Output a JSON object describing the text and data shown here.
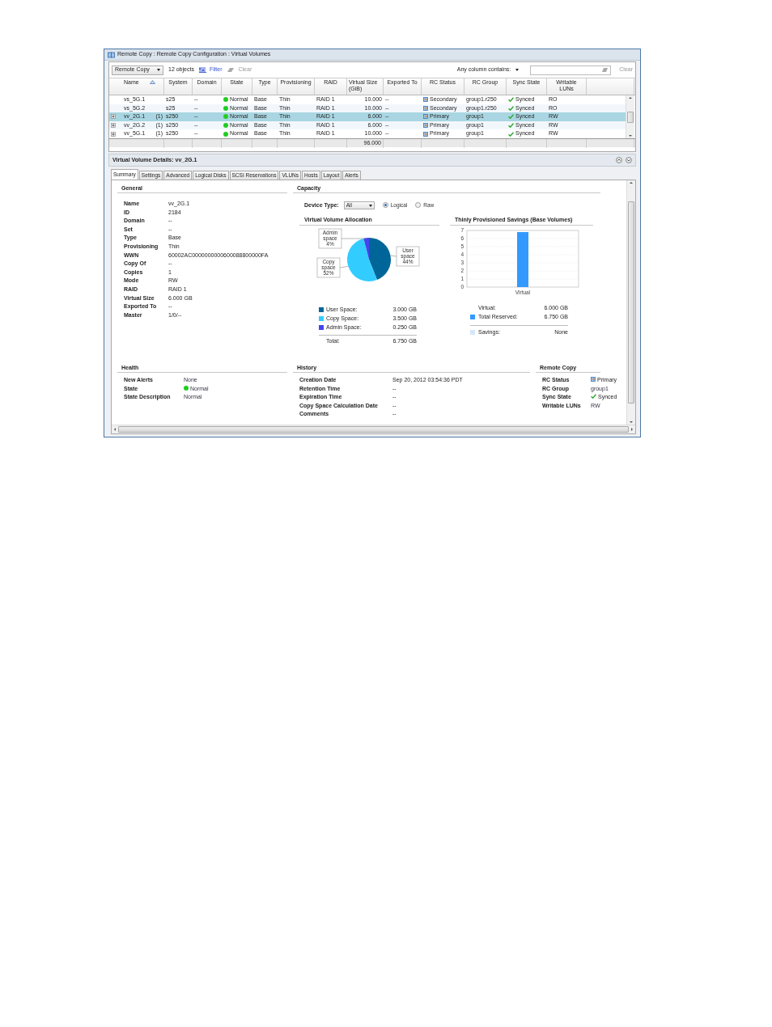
{
  "window": {
    "title": "Remote Copy : Remote Copy Configuration : Virtual Volumes"
  },
  "toolbar": {
    "view_select": "Remote Copy",
    "object_count": "12 objects",
    "filter": "Filter",
    "clear": {
      "label": "Clear",
      "disabled": true
    },
    "search_label": "Any column contains:",
    "search_clear": "Clear"
  },
  "table": {
    "columns": [
      "Name",
      "System",
      "Domain",
      "State",
      "Type",
      "Provisioning",
      "RAID",
      "Virtual Size (GiB)",
      "Exported To",
      "RC Status",
      "RC Group",
      "Sync State",
      "Writable LUNs"
    ],
    "rows": [
      {
        "expandable": false,
        "selected": false,
        "name": "vs_5G.1",
        "system": "s25",
        "domain": "--",
        "state": "Normal",
        "type": "Base",
        "provisioning": "Thin",
        "raid": "RAID 1",
        "virtual_size": "10.000",
        "exported_to": "--",
        "rc_status": "Secondary",
        "rc_group": "group1.r250",
        "sync_state": "Synced",
        "writable_luns": "RO"
      },
      {
        "expandable": false,
        "selected": false,
        "name": "vs_5G.2",
        "system": "s25",
        "domain": "--",
        "state": "Normal",
        "type": "Base",
        "provisioning": "Thin",
        "raid": "RAID 1",
        "virtual_size": "10.000",
        "exported_to": "--",
        "rc_status": "Secondary",
        "rc_group": "group1.r250",
        "sync_state": "Synced",
        "writable_luns": "RO"
      },
      {
        "expandable": true,
        "selected": true,
        "name": "vv_2G.1",
        "count": "(1)",
        "system": "s250",
        "domain": "--",
        "state": "Normal",
        "type": "Base",
        "provisioning": "Thin",
        "raid": "RAID 1",
        "virtual_size": "6.000",
        "exported_to": "--",
        "rc_status": "Primary",
        "rc_group": "group1",
        "sync_state": "Synced",
        "writable_luns": "RW"
      },
      {
        "expandable": true,
        "selected": false,
        "name": "vv_2G.2",
        "count": "(1)",
        "system": "s250",
        "domain": "--",
        "state": "Normal",
        "type": "Base",
        "provisioning": "Thin",
        "raid": "RAID 1",
        "virtual_size": "6.000",
        "exported_to": "--",
        "rc_status": "Primary",
        "rc_group": "group1",
        "sync_state": "Synced",
        "writable_luns": "RW"
      },
      {
        "expandable": true,
        "selected": false,
        "name": "vv_5G.1",
        "count": "(1)",
        "system": "s250",
        "domain": "--",
        "state": "Normal",
        "type": "Base",
        "provisioning": "Thin",
        "raid": "RAID 1",
        "virtual_size": "10.000",
        "exported_to": "--",
        "rc_status": "Primary",
        "rc_group": "group1",
        "sync_state": "Synced",
        "writable_luns": "RW"
      }
    ],
    "virtual_size_total": "96.000"
  },
  "details": {
    "title": "Virtual Volume Details: vv_2G.1",
    "tabs": [
      {
        "label": "Summary",
        "selected": true
      },
      {
        "label": "Settings",
        "selected": false
      },
      {
        "label": "Advanced",
        "selected": false
      },
      {
        "label": "Logical Disks",
        "selected": false
      },
      {
        "label": "SCSI Reservations",
        "selected": false
      },
      {
        "label": "VLUNs",
        "selected": false
      },
      {
        "label": "Hosts",
        "selected": false
      },
      {
        "label": "Layout",
        "selected": false
      },
      {
        "label": "Alerts",
        "selected": false
      }
    ],
    "general": {
      "title": "General",
      "fields": [
        {
          "label": "Name",
          "value": "vv_2G.1"
        },
        {
          "label": "ID",
          "value": "2184"
        },
        {
          "label": "Domain",
          "value": "--"
        },
        {
          "label": "Set",
          "value": "--"
        },
        {
          "label": "Type",
          "value": "Base"
        },
        {
          "label": "Provisioning",
          "value": "Thin"
        },
        {
          "label": "WWN",
          "value": "60002AC0000000000600088800000FA"
        },
        {
          "label": "Copy Of",
          "value": "--"
        },
        {
          "label": "Copies",
          "value": "1"
        },
        {
          "label": "Mode",
          "value": "RW"
        },
        {
          "label": "RAID",
          "value": "RAID 1"
        },
        {
          "label": "Virtual Size",
          "value": "6.000 GB"
        },
        {
          "label": "Exported To",
          "value": "--"
        },
        {
          "label": "Master",
          "value": "1/0/--"
        }
      ]
    },
    "capacity": {
      "title": "Capacity",
      "device_type_label": "Device Type:",
      "device_type": "All",
      "modes": [
        {
          "label": "Logical",
          "selected": true
        },
        {
          "label": "Raw",
          "selected": false
        }
      ],
      "allocation": {
        "title": "Virtual Volume Allocation",
        "chart_data": {
          "type": "pie",
          "categories": [
            "User space",
            "Copy space",
            "Admin space"
          ],
          "values": [
            44,
            52,
            4
          ],
          "value_labels": [
            "44%",
            "52%",
            "4%"
          ]
        },
        "legend": [
          {
            "label": "User Space:",
            "value": "3.000 GB",
            "color": "#006699"
          },
          {
            "label": "Copy Space:",
            "value": "3.500 GB",
            "color": "#33ccff"
          },
          {
            "label": "Admin Space:",
            "value": "0.250 GB",
            "color": "#4444ee"
          }
        ],
        "total_label": "Total:",
        "total_value": "6.750 GB"
      },
      "savings": {
        "title": "Thinly Provisioned Savings (Base Volumes)",
        "chart_data": {
          "type": "bar",
          "categories": [
            "Virtual"
          ],
          "series": [
            {
              "color": "#3399ff",
              "values": [
                6.8
              ]
            }
          ],
          "ylim": [
            0,
            7
          ],
          "yticks": [
            0,
            1,
            2,
            3,
            4,
            5,
            6,
            7
          ],
          "grid": true
        },
        "rows": [
          {
            "label": "Virtual:",
            "value": "6.000 GB"
          },
          {
            "label": "Total Reserved:",
            "value": "6.750 GB",
            "color": "#3399ff"
          },
          {
            "label": "Savings:",
            "value": "None",
            "color": "#d6e8f8"
          }
        ]
      }
    },
    "health": {
      "title": "Health",
      "fields": [
        {
          "label": "New Alerts",
          "value": "None",
          "kind": "text"
        },
        {
          "label": "State",
          "value": "Normal",
          "kind": "status"
        },
        {
          "label": "State Description",
          "value": "Normal",
          "kind": "text"
        }
      ]
    },
    "history": {
      "title": "History",
      "fields": [
        {
          "label": "Creation Date",
          "value": "Sep 20, 2012 03:54:36 PDT"
        },
        {
          "label": "Retention Time",
          "value": "--"
        },
        {
          "label": "Expiration Time",
          "value": "--"
        },
        {
          "label": "Copy Space Calculation Date",
          "value": "--"
        },
        {
          "label": "Comments",
          "value": "--"
        }
      ]
    },
    "remote_copy": {
      "title": "Remote Copy",
      "fields": [
        {
          "label": "RC Status",
          "value": "Primary",
          "kind": "rc"
        },
        {
          "label": "RC Group",
          "value": "group1",
          "kind": "text"
        },
        {
          "label": "Sync State",
          "value": "Synced",
          "kind": "synced"
        },
        {
          "label": "Writable LUNs",
          "value": "RW",
          "kind": "text"
        }
      ]
    }
  }
}
